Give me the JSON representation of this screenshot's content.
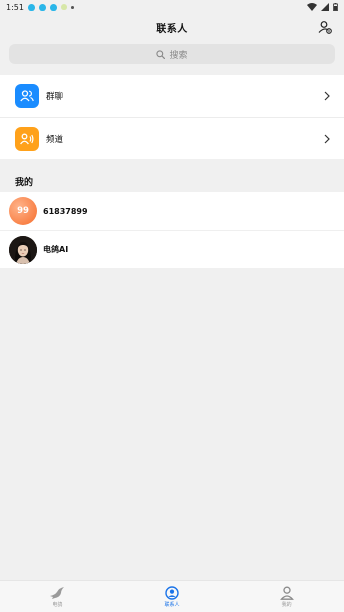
{
  "status_bar": {
    "time": "1:51"
  },
  "header": {
    "title": "联系人",
    "action_icon": "add-contact-icon"
  },
  "search": {
    "placeholder": "搜索",
    "icon": "search-icon"
  },
  "top_list": [
    {
      "label": "群聊",
      "icon": "group-chat-icon",
      "color": "#1a8cff"
    },
    {
      "label": "频道",
      "icon": "channel-icon",
      "color": "#ffa11a"
    }
  ],
  "mine": {
    "title": "我的",
    "contacts": [
      {
        "name": "61837899",
        "avatar_text": "99"
      },
      {
        "name": "电鸽AI",
        "avatar_icon": "ai-portrait-icon"
      }
    ]
  },
  "bottom_nav": [
    {
      "label": "电鸽",
      "icon": "dove-icon",
      "active": false
    },
    {
      "label": "联系人",
      "icon": "contacts-icon",
      "active": true
    },
    {
      "label": "我的",
      "icon": "profile-icon",
      "active": false
    }
  ],
  "colors": {
    "accent": "#1a73e8",
    "background": "#f0f0f0"
  }
}
